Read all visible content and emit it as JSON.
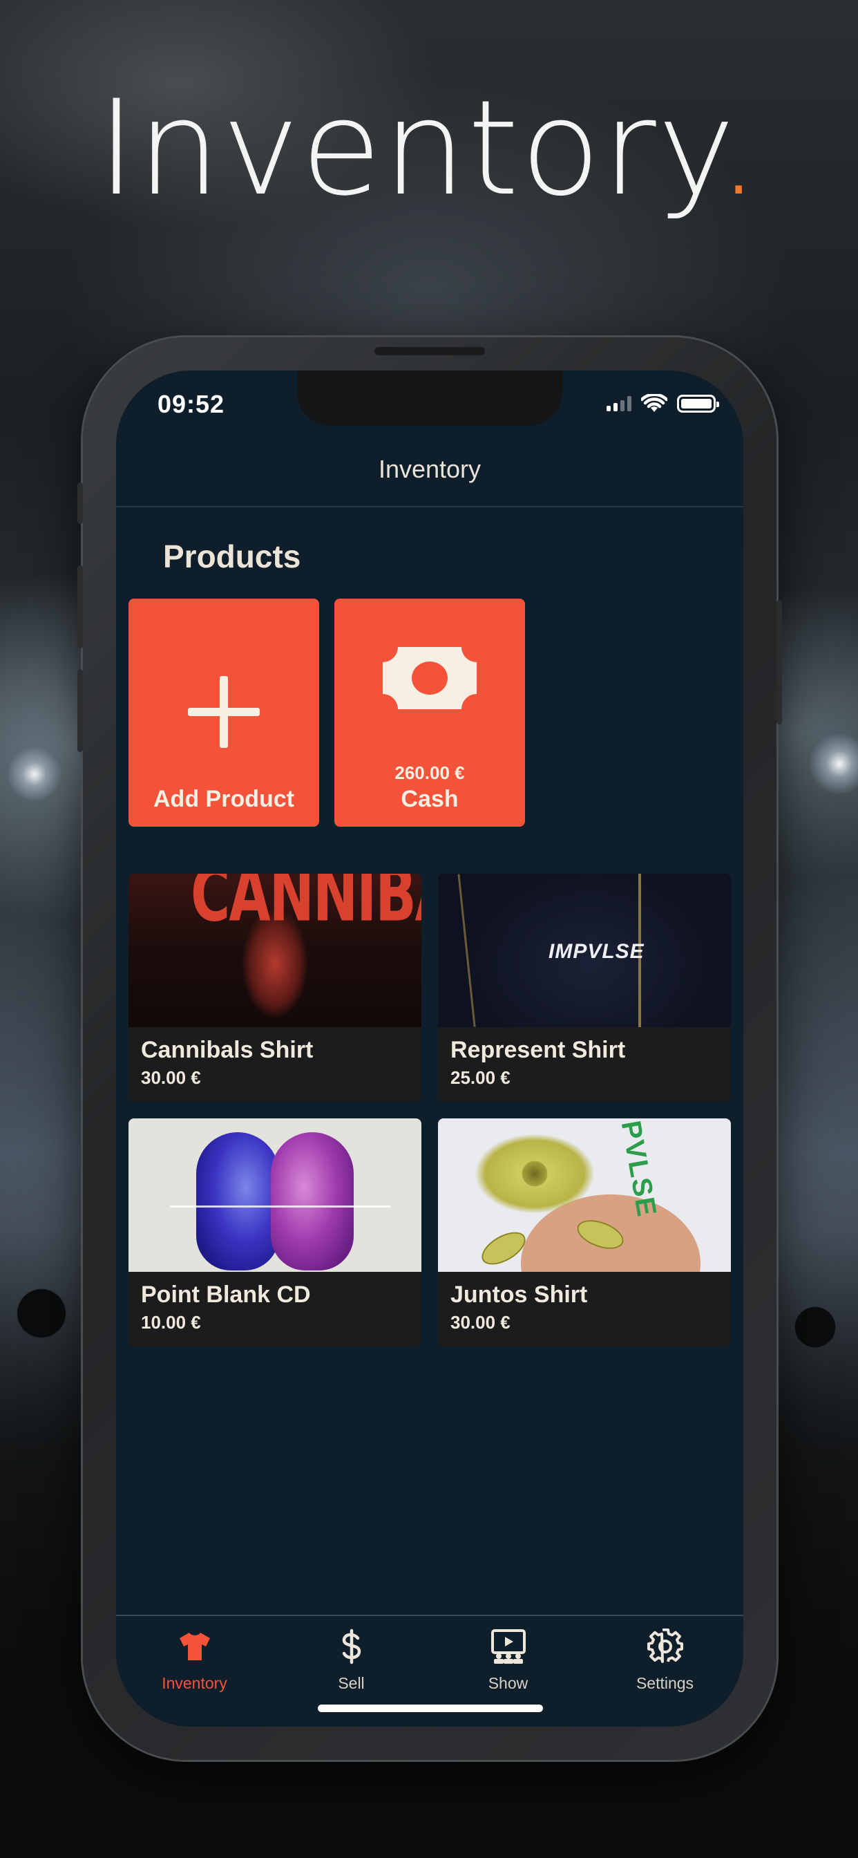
{
  "headline": {
    "text": "Inventory",
    "dot": "."
  },
  "status_bar": {
    "time": "09:52"
  },
  "nav": {
    "title": "Inventory"
  },
  "section": {
    "title": "Products"
  },
  "actions": {
    "add_label": "Add Product",
    "cash_amount": "260.00 €",
    "cash_label": "Cash"
  },
  "products": [
    {
      "name": "Cannibals Shirt",
      "price": "30.00 €",
      "image_text": "CANNIBALS"
    },
    {
      "name": "Represent Shirt",
      "price": "25.00 €",
      "image_text": "IMPVLSE"
    },
    {
      "name": "Point Blank CD",
      "price": "10.00 €"
    },
    {
      "name": "Juntos Shirt",
      "price": "30.00 €",
      "image_text": "PVLSE"
    }
  ],
  "tabs": [
    {
      "label": "Inventory",
      "icon": "tshirt-icon",
      "active": true
    },
    {
      "label": "Sell",
      "icon": "dollar-icon",
      "active": false
    },
    {
      "label": "Show",
      "icon": "stage-icon",
      "active": false
    },
    {
      "label": "Settings",
      "icon": "gear-icon",
      "active": false
    }
  ],
  "colors": {
    "accent": "#f4533a",
    "headline_dot": "#f07a2c",
    "screen_bg": "#0f1e2b",
    "card_bg": "#1c1c1d",
    "text_cream": "#ece4d6"
  }
}
